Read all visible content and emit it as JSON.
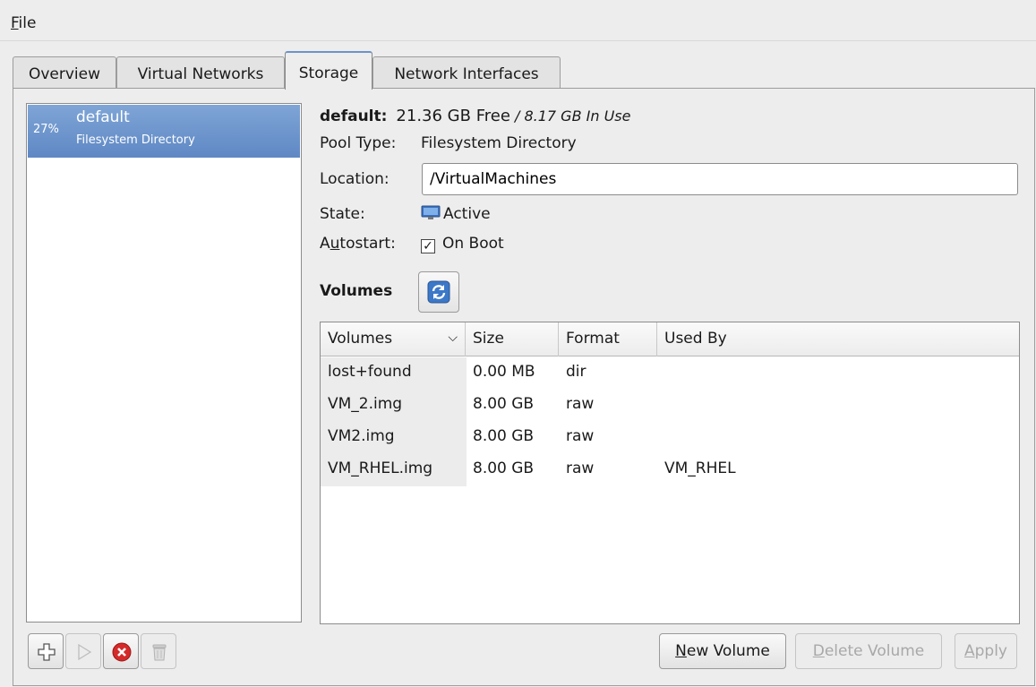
{
  "menubar": {
    "file": "File",
    "file_mnemonic": "F",
    "file_rest": "ile"
  },
  "tabs": [
    {
      "label": "Overview"
    },
    {
      "label": "Virtual Networks"
    },
    {
      "label": "Storage"
    },
    {
      "label": "Network Interfaces"
    }
  ],
  "pools": [
    {
      "percent": "27%",
      "name": "default",
      "type": "Filesystem Directory"
    }
  ],
  "details": {
    "name": "default:",
    "free": "21.36 GB Free",
    "in_use": " / 8.17 GB In Use",
    "pool_type_label": "Pool Type:",
    "pool_type": "Filesystem Directory",
    "location_label": "Location:",
    "location": "/VirtualMachines",
    "state_label": "State:",
    "state": "Active",
    "autostart_label_pre": "A",
    "autostart_label_mnemonic": "u",
    "autostart_label_post": "tostart:",
    "autostart_value": "On Boot",
    "autostart_checked": true
  },
  "volumes": {
    "title": "Volumes",
    "columns": [
      "Volumes",
      "Size",
      "Format",
      "Used By"
    ],
    "rows": [
      {
        "name": "lost+found",
        "size": "0.00 MB",
        "format": "dir",
        "used_by": ""
      },
      {
        "name": "VM_2.img",
        "size": "8.00 GB",
        "format": "raw",
        "used_by": ""
      },
      {
        "name": "VM2.img",
        "size": "8.00 GB",
        "format": "raw",
        "used_by": ""
      },
      {
        "name": "VM_RHEL.img",
        "size": "8.00 GB",
        "format": "raw",
        "used_by": "VM_RHEL"
      }
    ]
  },
  "buttons": {
    "new_volume_mnemonic": "N",
    "new_volume_rest": "ew Volume",
    "delete_volume_mnemonic": "D",
    "delete_volume_rest": "elete Volume",
    "apply_mnemonic": "A",
    "apply_rest": "pply"
  },
  "icons": {
    "add_pool": "plus-icon",
    "start_pool": "play-icon",
    "stop_pool": "stop-icon",
    "delete_pool": "trash-icon",
    "refresh": "refresh-icon",
    "state": "monitor-icon"
  }
}
